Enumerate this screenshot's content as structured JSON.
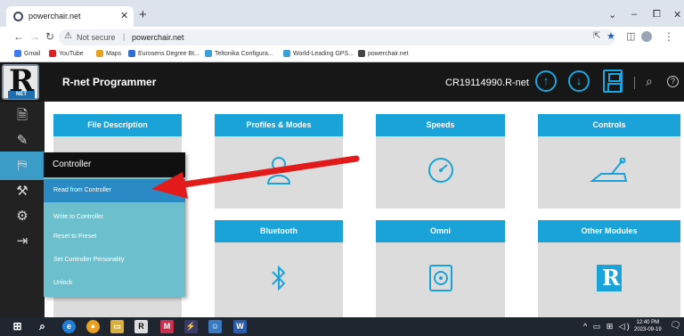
{
  "browser": {
    "tab_title": "powerchair.net",
    "tab_close": "✕",
    "new_tab": "+",
    "window_controls": [
      "⌄",
      "–",
      "⧠",
      "✕"
    ],
    "security_label": "Not secure",
    "address_sep": "|",
    "url": "powerchair.net",
    "bookmarks": [
      {
        "label": "Gmail",
        "icon": "gmail-icon",
        "color": "#3d7cf0"
      },
      {
        "label": "YouTube",
        "icon": "youtube-icon",
        "color": "#e02020"
      },
      {
        "label": "Maps",
        "icon": "maps-icon",
        "color": "#e8a020"
      },
      {
        "label": "Eurosens Degree Bt...",
        "icon": "eurosens-icon",
        "color": "#2f6fd0"
      },
      {
        "label": "Teltonika Configura...",
        "icon": "teltonika-icon",
        "color": "#3aa0d8"
      },
      {
        "label": "World-Leading GPS...",
        "icon": "gps-icon",
        "color": "#3aa0d8"
      },
      {
        "label": "powerchair.net",
        "icon": "globe-icon",
        "color": "#444444"
      }
    ]
  },
  "app": {
    "logo_letter": "R",
    "logo_tag": "NET",
    "title": "R-net Programmer",
    "filename": "CR19114990.R-net",
    "accent": "#1aa3d8"
  },
  "cards": [
    {
      "label": "File Description",
      "icon": "file-description-icon"
    },
    {
      "label": "Profiles & Modes",
      "icon": "user-icon"
    },
    {
      "label": "Speeds",
      "icon": "speedometer-icon"
    },
    {
      "label": "Controls",
      "icon": "joystick-icon"
    },
    {
      "label": "",
      "icon": "hidden-card"
    },
    {
      "label": "Bluetooth",
      "icon": "bluetooth-icon"
    },
    {
      "label": "Omni",
      "icon": "omni-device-icon"
    },
    {
      "label": "Other Modules",
      "icon": "rnet-module-icon"
    }
  ],
  "popup": {
    "title": "Controller",
    "items": [
      "Read from Controller",
      "Write to Controller",
      "Reset to Preset",
      "Set Controller Personality",
      "Unlock"
    ]
  },
  "taskbar": {
    "time": "12:40 PM",
    "date": "2023-09-19"
  }
}
